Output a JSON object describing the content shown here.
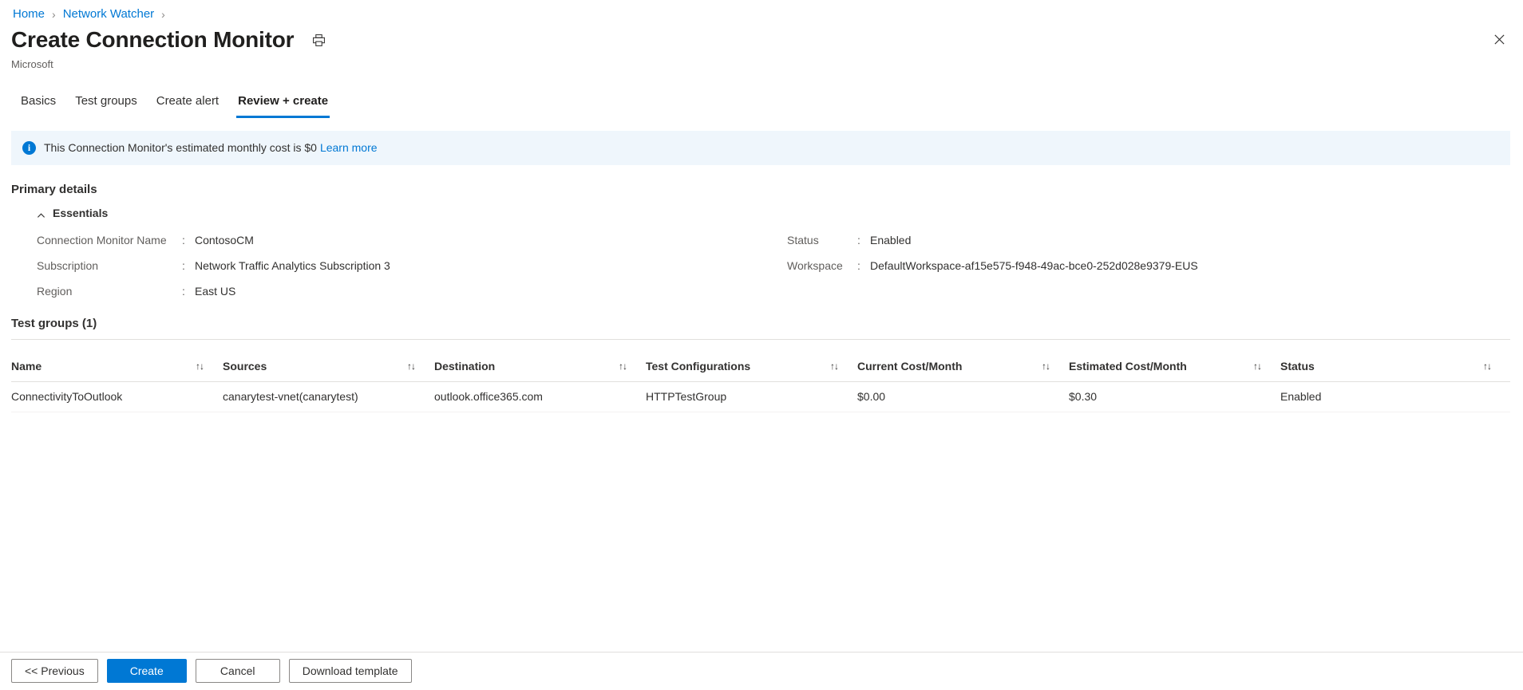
{
  "breadcrumb": {
    "items": [
      {
        "label": "Home"
      },
      {
        "label": "Network Watcher"
      }
    ],
    "separator": "›"
  },
  "header": {
    "title": "Create Connection Monitor",
    "subtitle": "Microsoft",
    "print_icon": "print-icon",
    "close_icon": "close-icon"
  },
  "tabs": [
    {
      "label": "Basics",
      "active": false
    },
    {
      "label": "Test groups",
      "active": false
    },
    {
      "label": "Create alert",
      "active": false
    },
    {
      "label": "Review + create",
      "active": true
    }
  ],
  "banner": {
    "icon": "info-icon",
    "icon_glyph": "i",
    "text": "This Connection Monitor's estimated monthly cost is $0",
    "link_text": "Learn more",
    "background": "#eff6fc",
    "accent": "#0078d4"
  },
  "primary_details": {
    "heading": "Primary details",
    "essentials_label": "Essentials",
    "essentials_expanded": true,
    "left": [
      {
        "label": "Connection Monitor Name",
        "colon": ":",
        "value": "ContosoCM"
      },
      {
        "label": "Subscription",
        "colon": ":",
        "value": "Network Traffic Analytics Subscription 3"
      },
      {
        "label": "Region",
        "colon": ":",
        "value": "East US"
      }
    ],
    "right": [
      {
        "label": "Status",
        "colon": ":",
        "value": "Enabled"
      },
      {
        "label": "Workspace",
        "colon": ":",
        "value": "DefaultWorkspace-af15e575-f948-49ac-bce0-252d028e9379-EUS"
      }
    ]
  },
  "test_groups": {
    "heading": "Test groups (1)",
    "sort_icon": "↑↓",
    "columns": [
      "Name",
      "Sources",
      "Destination",
      "Test Configurations",
      "Current Cost/Month",
      "Estimated Cost/Month",
      "Status"
    ],
    "rows": [
      {
        "name": "ConnectivityToOutlook",
        "sources": "canarytest-vnet(canarytest)",
        "destination": "outlook.office365.com",
        "test_configurations": "HTTPTestGroup",
        "current_cost": "$0.00",
        "estimated_cost": "$0.30",
        "status": "Enabled"
      }
    ]
  },
  "footer": {
    "previous_label": "<< Previous",
    "create_label": "Create",
    "cancel_label": "Cancel",
    "download_label": "Download template",
    "primary_color": "#0078d4"
  }
}
